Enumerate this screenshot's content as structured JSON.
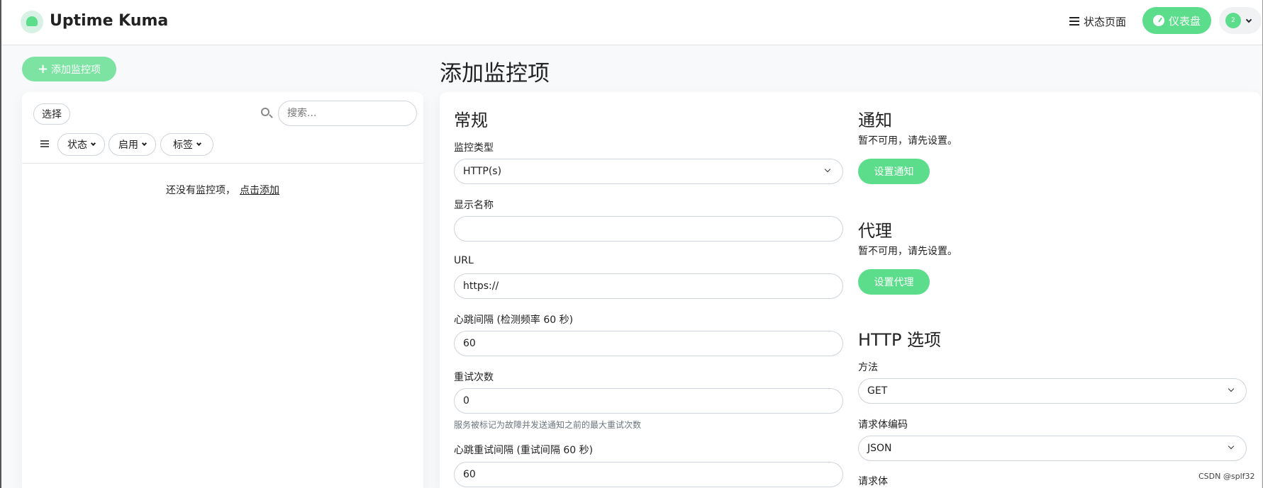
{
  "header": {
    "brand": "Uptime Kuma",
    "status_page": "状态页面",
    "dashboard": "仪表盘",
    "avatar_badge": "2"
  },
  "sidebar": {
    "add_monitor": "添加监控项",
    "select": "选择",
    "search_placeholder": "搜索...",
    "filters": [
      "状态",
      "启用",
      "标签"
    ],
    "empty_text": "还没有监控项，",
    "empty_link": "点击添加"
  },
  "main": {
    "title": "添加监控项",
    "general": {
      "title": "常规",
      "monitor_type_label": "监控类型",
      "monitor_type_value": "HTTP(s)",
      "friendly_name_label": "显示名称",
      "friendly_name_value": "",
      "url_label": "URL",
      "url_value": "https://",
      "interval_label": "心跳间隔 (检测频率 60 秒)",
      "interval_value": "60",
      "retries_label": "重试次数",
      "retries_value": "0",
      "retries_help": "服务被标记为故障并发送通知之前的最大重试次数",
      "retry_interval_label": "心跳重试间隔 (重试间隔 60 秒)",
      "retry_interval_value": "60"
    },
    "notifications": {
      "title": "通知",
      "unavailable": "暂不可用，请先设置。",
      "setup_button": "设置通知"
    },
    "proxy": {
      "title": "代理",
      "unavailable": "暂不可用，请先设置。",
      "setup_button": "设置代理"
    },
    "http_options": {
      "title": "HTTP 选项",
      "method_label": "方法",
      "method_value": "GET",
      "body_encoding_label": "请求体编码",
      "body_encoding_value": "JSON",
      "body_label": "请求体"
    }
  },
  "watermark": "CSDN @splf32",
  "colors": {
    "primary": "#5cdd8b"
  }
}
